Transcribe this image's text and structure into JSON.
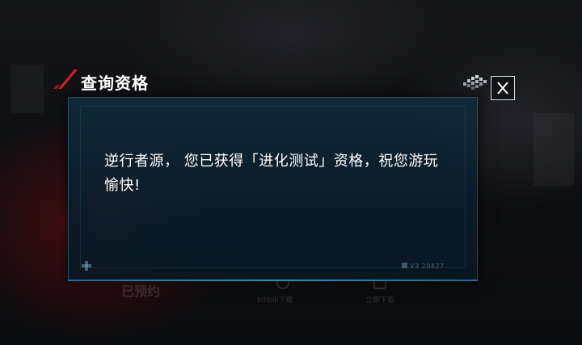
{
  "dialog": {
    "title": "查询资格",
    "message": "逆行者源， 您已获得「进化测试」资格，祝您游玩愉快!",
    "close_label": "X",
    "version_text": "V3.20427"
  },
  "background": {
    "bottom_left_label": "已预约",
    "bottom_mid_label": "bilibili下载",
    "bottom_right_label": "立即下载"
  },
  "icons": {
    "title_accent": "red-slash-icon",
    "close": "close-icon",
    "pixel_deco": "pixel-cluster-icon",
    "cross_deco": "plus-cross-icon"
  },
  "colors": {
    "accent_red": "#d0202a",
    "frame_blue": "#2a8ec0",
    "dialog_bg": "#0f2a3a",
    "text": "#ffffff"
  }
}
